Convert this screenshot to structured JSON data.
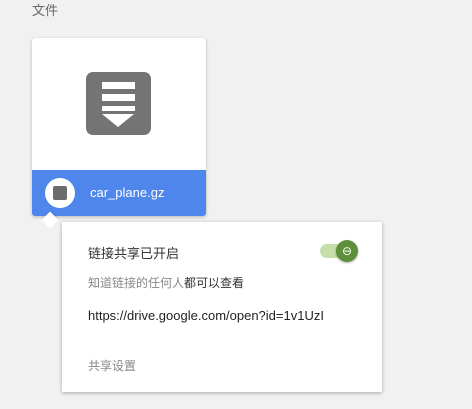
{
  "section_title": "文件",
  "file": {
    "name": "car_plane.gz",
    "icon": "archive-file-icon",
    "accent": "#4f86ec"
  },
  "popup": {
    "link_sharing_label": "链接共享已开启",
    "access_prefix": "知道链接的任何人",
    "access_suffix": "都可以查看",
    "url": "https://drive.google.com/open?id=1v1UzI",
    "sharing_settings": "共享设置",
    "toggle_on": true,
    "toggle_color": "#5e8f3a"
  }
}
